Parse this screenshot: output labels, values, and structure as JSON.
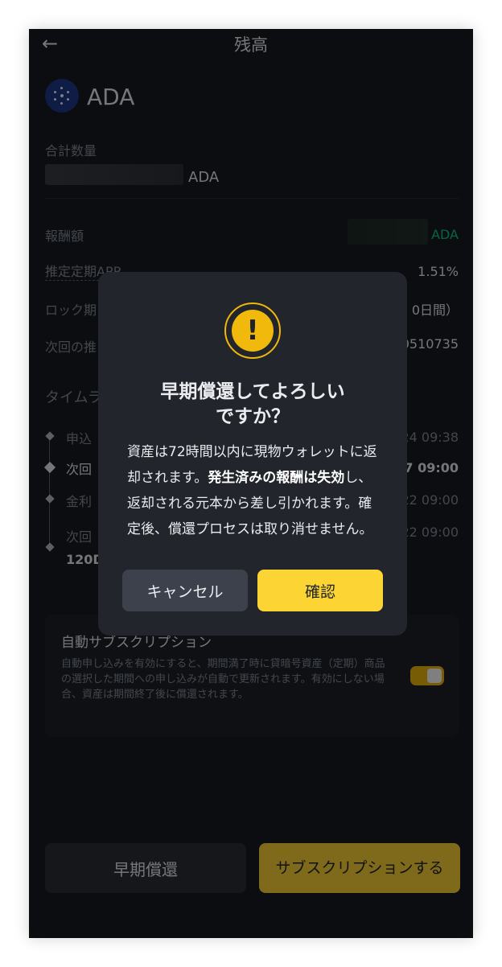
{
  "header": {
    "title": "残高",
    "back_icon": "←"
  },
  "coin": {
    "name": "ADA"
  },
  "total": {
    "label": "合計数量",
    "unit": "ADA"
  },
  "reward": {
    "label": "報酬額",
    "unit": "ADA"
  },
  "apr": {
    "label": "推定定期APR",
    "value": "1.51%"
  },
  "lock": {
    "label_partial": "ロック期",
    "value_partial": "0日間）"
  },
  "next": {
    "label_partial": "次回の推",
    "value_partial": "0510735"
  },
  "timeline": {
    "title_partial": "タイムラ",
    "items": [
      {
        "label_partial": "申込",
        "date_partial": "24 09:38"
      },
      {
        "label_partial": "次回",
        "date_partial": "7 09:00"
      },
      {
        "label_partial": "金利",
        "date_partial": "22 09:00"
      },
      {
        "label_partial": "次回",
        "date_partial": "22 09:00"
      }
    ],
    "footer_partial": "120D"
  },
  "auto": {
    "title": "自動サブスクリプション",
    "description": "自動申し込みを有効にすると、期間満了時に貸暗号資産（定期）商品の選択した期間への申し込みが自動で更新されます。有効にしない場合、資産は期間終了後に償還されます。"
  },
  "buttons": {
    "early": "早期償還",
    "subscribe": "サブスクリプションする"
  },
  "dialog": {
    "icon": "!",
    "title_line1": "早期償還してよろしい",
    "title_line2": "ですか？",
    "body_pre": "資産は72時間以内に現物ウォレットに返却されます。",
    "body_bold": "発生済みの報酬は失効",
    "body_post": "し、返却される元本から差し引かれます。確定後、償還プロセスは取り消せません。",
    "cancel": "キャンセル",
    "confirm": "確認"
  },
  "colors": {
    "accent": "#fcd535",
    "warning": "#f0b90b",
    "green": "#0ecb81",
    "bg": "#181a20"
  }
}
